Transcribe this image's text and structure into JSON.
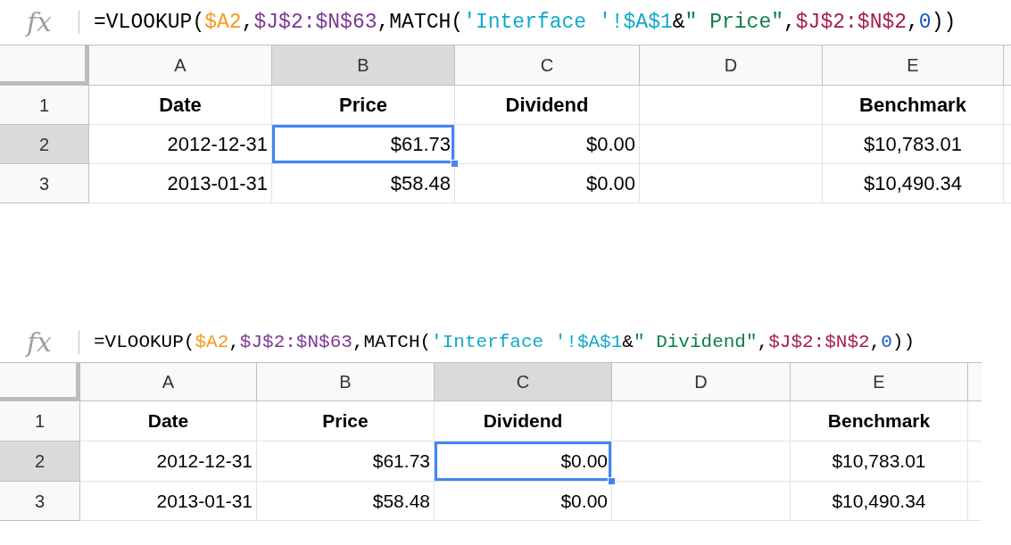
{
  "panels": [
    {
      "fx": "fx",
      "formula": [
        {
          "text": "=VLOOKUP(",
          "color": "#000000"
        },
        {
          "text": "$A2",
          "color": "#f7981d"
        },
        {
          "text": ",",
          "color": "#000000"
        },
        {
          "text": "$J$2:$N$63",
          "color": "#7e3794"
        },
        {
          "text": ",MATCH(",
          "color": "#000000"
        },
        {
          "text": "'Interface '!$A$1",
          "color": "#11a9cc"
        },
        {
          "text": "&",
          "color": "#000000"
        },
        {
          "text": "\" Price\"",
          "color": "#0b8043"
        },
        {
          "text": ",",
          "color": "#000000"
        },
        {
          "text": "$J$2:$N$2",
          "color": "#a61d4c"
        },
        {
          "text": ",",
          "color": "#000000"
        },
        {
          "text": "0",
          "color": "#1155cc"
        },
        {
          "text": "))",
          "color": "#000000"
        }
      ],
      "columns": [
        {
          "label": "A",
          "selected": false
        },
        {
          "label": "B",
          "selected": true
        },
        {
          "label": "C",
          "selected": false
        },
        {
          "label": "D",
          "selected": false
        },
        {
          "label": "E",
          "selected": false
        }
      ],
      "rows": [
        {
          "number": "1",
          "kind": "header",
          "selected": false,
          "cells": [
            {
              "text": "Date",
              "selected": false
            },
            {
              "text": "Price",
              "selected": false
            },
            {
              "text": "Dividend",
              "selected": false
            },
            {
              "selected": false
            },
            {
              "text": "Benchmark",
              "selected": false
            }
          ]
        },
        {
          "number": "2",
          "kind": "data",
          "selected": true,
          "cells": [
            {
              "text": "2012-12-31",
              "selected": false
            },
            {
              "text": "$61.73",
              "selected": true
            },
            {
              "text": "$0.00",
              "selected": false
            },
            {
              "selected": false
            },
            {
              "text": "$10,783.01",
              "selected": false
            }
          ]
        },
        {
          "number": "3",
          "kind": "data",
          "selected": false,
          "cells": [
            {
              "text": "2013-01-31",
              "selected": false
            },
            {
              "text": "$58.48",
              "selected": false
            },
            {
              "text": "$0.00",
              "selected": false
            },
            {
              "selected": false
            },
            {
              "text": "$10,490.34",
              "selected": false
            }
          ]
        }
      ]
    },
    {
      "fx": "fx",
      "formula": [
        {
          "text": "=VLOOKUP(",
          "color": "#000000"
        },
        {
          "text": "$A2",
          "color": "#f7981d"
        },
        {
          "text": ",",
          "color": "#000000"
        },
        {
          "text": "$J$2:$N$63",
          "color": "#7e3794"
        },
        {
          "text": ",MATCH(",
          "color": "#000000"
        },
        {
          "text": "'Interface '!$A$1",
          "color": "#11a9cc"
        },
        {
          "text": "&",
          "color": "#000000"
        },
        {
          "text": "\" Dividend\"",
          "color": "#0b8043"
        },
        {
          "text": ",",
          "color": "#000000"
        },
        {
          "text": "$J$2:$N$2",
          "color": "#a61d4c"
        },
        {
          "text": ",",
          "color": "#000000"
        },
        {
          "text": "0",
          "color": "#1155cc"
        },
        {
          "text": "))",
          "color": "#000000"
        }
      ],
      "columns": [
        {
          "label": "A",
          "selected": false
        },
        {
          "label": "B",
          "selected": false
        },
        {
          "label": "C",
          "selected": true
        },
        {
          "label": "D",
          "selected": false
        },
        {
          "label": "E",
          "selected": false
        }
      ],
      "rows": [
        {
          "number": "1",
          "kind": "header",
          "selected": false,
          "cells": [
            {
              "text": "Date",
              "selected": false
            },
            {
              "text": "Price",
              "selected": false
            },
            {
              "text": "Dividend",
              "selected": false
            },
            {
              "selected": false
            },
            {
              "text": "Benchmark",
              "selected": false
            }
          ]
        },
        {
          "number": "2",
          "kind": "data",
          "selected": true,
          "cells": [
            {
              "text": "2012-12-31",
              "selected": false
            },
            {
              "text": "$61.73",
              "selected": false
            },
            {
              "text": "$0.00",
              "selected": true
            },
            {
              "selected": false
            },
            {
              "text": "$10,783.01",
              "selected": false
            }
          ]
        },
        {
          "number": "3",
          "kind": "data",
          "selected": false,
          "cells": [
            {
              "text": "2013-01-31",
              "selected": false
            },
            {
              "text": "$58.48",
              "selected": false
            },
            {
              "text": "$0.00",
              "selected": false
            },
            {
              "selected": false
            },
            {
              "text": "$10,490.34",
              "selected": false
            }
          ]
        }
      ]
    }
  ]
}
